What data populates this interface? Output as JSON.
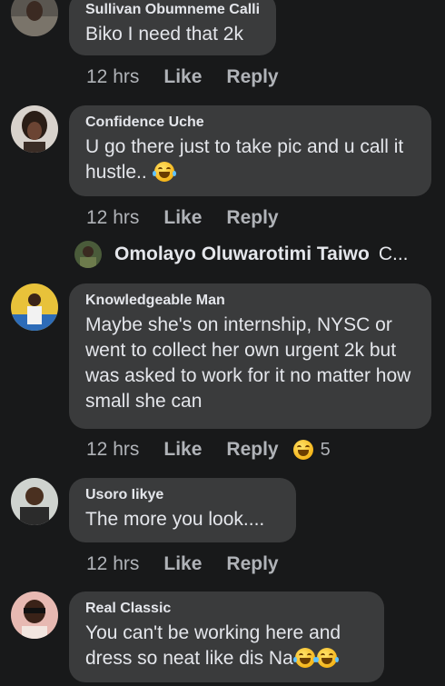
{
  "comments": [
    {
      "author": "Sullivan Obumneme Calli",
      "text": "Biko I need that 2k",
      "time": "12 hrs",
      "like": "Like",
      "reply": "Reply"
    },
    {
      "author": "Confidence Uche",
      "text": "U go there just to take pic and u call it hustle..",
      "time": "12 hrs",
      "like": "Like",
      "reply": "Reply"
    },
    {
      "author": "Knowledgeable Man",
      "text": "Maybe she's on internship, NYSC or went to collect her own urgent 2k but was asked to work for it no matter how small she can",
      "time": "12 hrs",
      "like": "Like",
      "reply": "Reply",
      "reaction_count": "5"
    },
    {
      "author": "Usoro Iikye",
      "text": "The more you look....",
      "time": "12 hrs",
      "like": "Like",
      "reply": "Reply"
    },
    {
      "author": "Real Classic",
      "text": "You can't be working here and dress so neat like dis Na"
    }
  ],
  "reply_preview": {
    "author": "Omolayo Oluwarotimi Taiwo",
    "text": "C..."
  },
  "colors": {
    "background": "#18191a",
    "bubble": "#3a3b3c",
    "text": "#e4e6eb",
    "muted": "#b0b3b8"
  },
  "icons": [
    "laughing-crying-emoji-icon",
    "grinning-emoji-icon"
  ]
}
